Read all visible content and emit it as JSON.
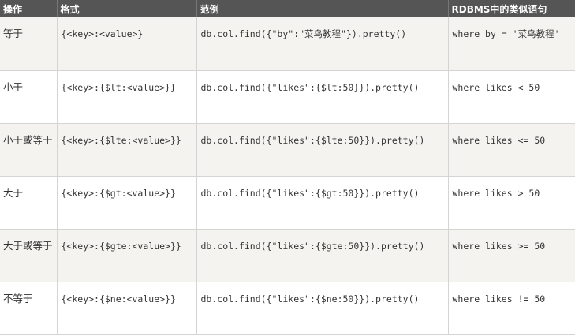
{
  "table": {
    "headers": [
      "操作",
      "格式",
      "范例",
      "RDBMS中的类似语句"
    ],
    "rows": [
      {
        "op": "等于",
        "format": "{<key>:<value>}",
        "example": "db.col.find({\"by\":\"菜鸟教程\"}).pretty()",
        "sql": "where by = '菜鸟教程'"
      },
      {
        "op": "小于",
        "format": "{<key>:{$lt:<value>}}",
        "example": "db.col.find({\"likes\":{$lt:50}}).pretty()",
        "sql": "where likes < 50"
      },
      {
        "op": "小于或等于",
        "format": "{<key>:{$lte:<value>}}",
        "example": "db.col.find({\"likes\":{$lte:50}}).pretty()",
        "sql": "where likes <= 50"
      },
      {
        "op": "大于",
        "format": "{<key>:{$gt:<value>}}",
        "example": "db.col.find({\"likes\":{$gt:50}}).pretty()",
        "sql": "where likes > 50"
      },
      {
        "op": "大于或等于",
        "format": "{<key>:{$gte:<value>}}",
        "example": "db.col.find({\"likes\":{$gte:50}}).pretty()",
        "sql": "where likes >= 50"
      },
      {
        "op": "不等于",
        "format": "{<key>:{$ne:<value>}}",
        "example": "db.col.find({\"likes\":{$ne:50}}).pretty()",
        "sql": "where likes != 50"
      }
    ]
  },
  "colors": {
    "header_bg": "#555555",
    "header_text": "#ffffff",
    "row_alt_bg": "#f5f3ef",
    "border": "#d4d4d4"
  }
}
